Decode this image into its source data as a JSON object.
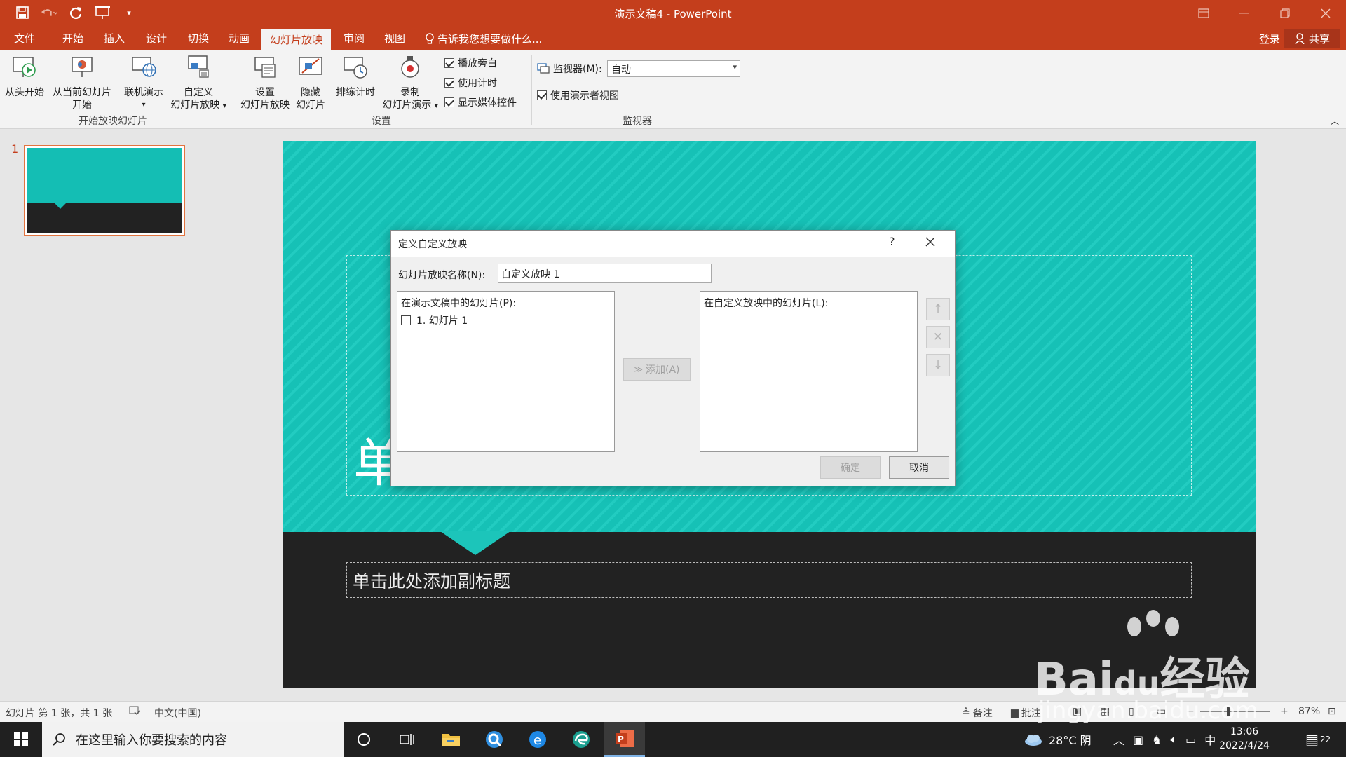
{
  "window": {
    "title": "演示文稿4 - PowerPoint"
  },
  "tabs": {
    "file": "文件",
    "home": "开始",
    "insert": "插入",
    "design": "设计",
    "transitions": "切换",
    "animations": "动画",
    "slideshow": "幻灯片放映",
    "review": "审阅",
    "view": "视图",
    "tellme": "告诉我您想要做什么...",
    "login": "登录",
    "share": "共享"
  },
  "ribbon": {
    "from_beginning": "从头开始",
    "from_current_1": "从当前幻灯片",
    "from_current_2": "开始",
    "online_1": "联机演示",
    "custom_1": "自定义",
    "custom_2": "幻灯片放映",
    "group_start": "开始放映幻灯片",
    "setup_1": "设置",
    "setup_2": "幻灯片放映",
    "hide_1": "隐藏",
    "hide_2": "幻灯片",
    "rehearse": "排练计时",
    "record_1": "录制",
    "record_2": "幻灯片演示",
    "chk_narration": "播放旁白",
    "chk_timings": "使用计时",
    "chk_media": "显示媒体控件",
    "group_setup": "设置",
    "monitor_label": "监视器(M):",
    "monitor_value": "自动",
    "chk_presenter": "使用演示者视图",
    "group_monitor": "监视器"
  },
  "thumbnail": {
    "number": "1"
  },
  "slide": {
    "title_partial": "单",
    "subtitle_placeholder": "单击此处添加副标题"
  },
  "dialog": {
    "title": "定义自定义放映",
    "help": "?",
    "name_label": "幻灯片放映名称(N):",
    "name_value": "自定义放映 1",
    "left_caption": "在演示文稿中的幻灯片(P):",
    "left_item": "1. 幻灯片 1",
    "add_label": "添加(A)",
    "right_caption": "在自定义放映中的幻灯片(L):",
    "ok": "确定",
    "cancel": "取消"
  },
  "status": {
    "slide_info": "幻灯片 第 1 张，共 1 张",
    "language": "中文(中国)",
    "notes": "备注",
    "comments": "批注",
    "zoom": "87%"
  },
  "taskbar": {
    "search_placeholder": "在这里输入你要搜索的内容",
    "weather": "28°C 阴",
    "ime": "中",
    "time": "13:06",
    "date": "2022/4/24",
    "notif_count": "22"
  },
  "watermark": {
    "brand": "Bai",
    "brand2": "du",
    "brand3": "经验",
    "url": "jingyan.baidu.com"
  },
  "colors": {
    "accent": "#c43e1c",
    "slide_teal": "#16c1b6",
    "slide_dark": "#222222"
  }
}
